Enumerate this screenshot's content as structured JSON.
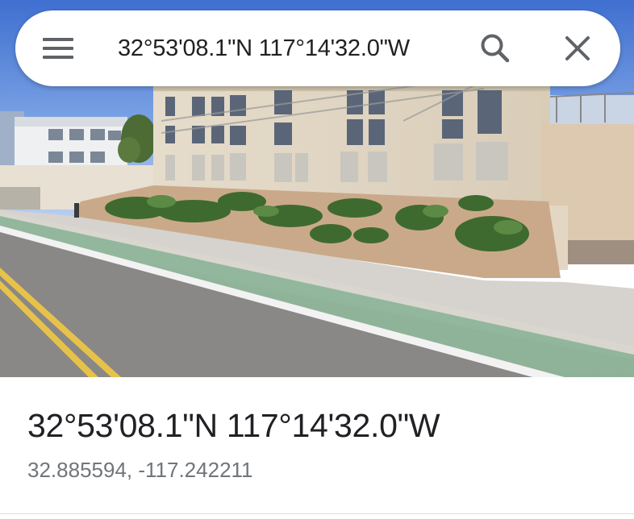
{
  "search": {
    "query": "32°53'08.1\"N 117°14'32.0\"W",
    "menu_icon": "hamburger-menu-icon",
    "search_icon": "search-icon",
    "close_icon": "close-icon"
  },
  "photo": {
    "kind": "street-view-image"
  },
  "place": {
    "title": "32°53'08.1\"N 117°14'32.0\"W",
    "decimal_coords": "32.885594, -117.242211"
  },
  "colors": {
    "text_primary": "#202124",
    "text_secondary": "#70757a",
    "icon_gray": "#5f6368",
    "bike_lane_green": "#8fb59a",
    "asphalt": "#8a8886"
  }
}
